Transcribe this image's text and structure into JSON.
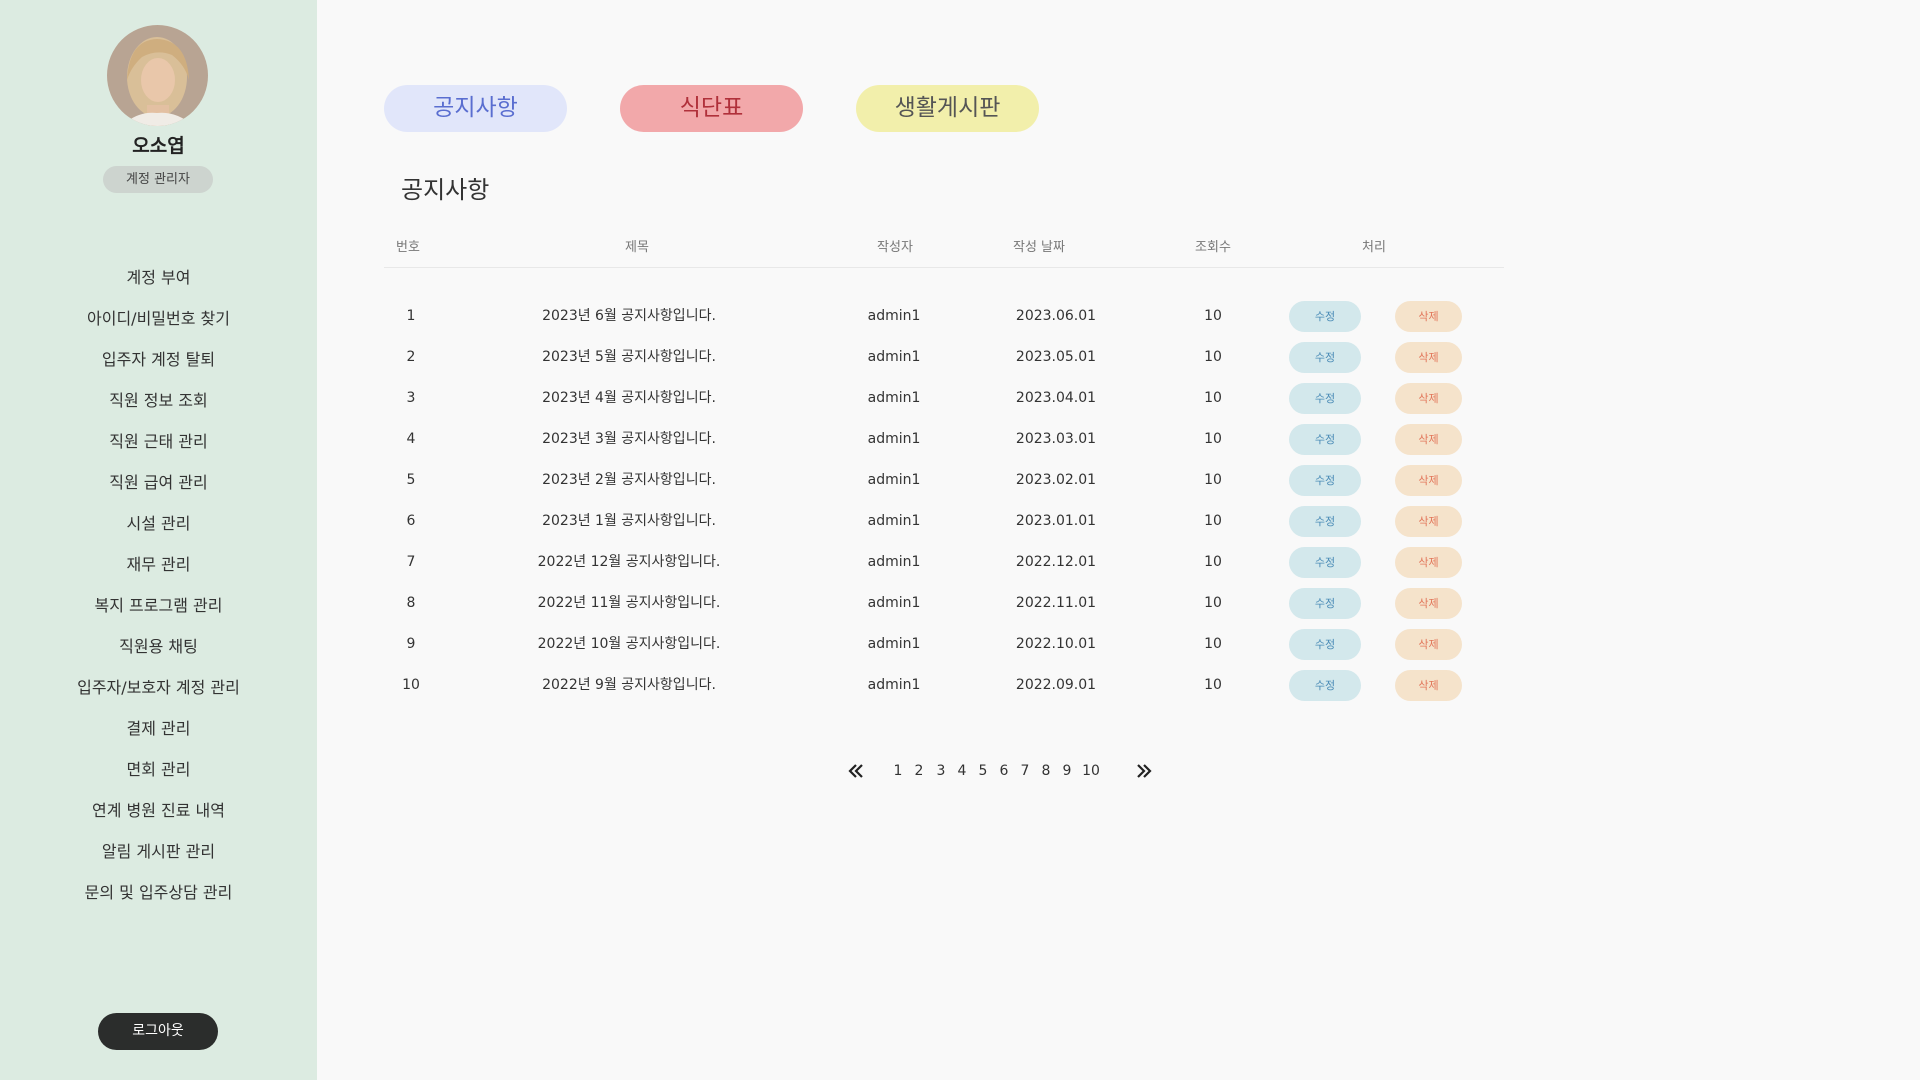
{
  "profile": {
    "name": "오소엽",
    "role": "계정 관리자"
  },
  "sidebar": {
    "items": [
      "계정 부여",
      "아이디/비밀번호 찾기",
      "입주자 계정 탈퇴",
      "직원 정보 조회",
      "직원 근태 관리",
      "직원 급여 관리",
      "시설 관리",
      "재무 관리",
      "복지 프로그램 관리",
      "직원용 채팅",
      "입주자/보호자 계정 관리",
      "결제 관리",
      "면회 관리",
      "연계 병원 진료 내역",
      "알림 게시판 관리",
      "문의 및 입주상담 관리"
    ],
    "logout": "로그아웃"
  },
  "tabs": {
    "notice": "공지사항",
    "menu": "식단표",
    "board": "생활게시판"
  },
  "section_title": "공지사항",
  "table": {
    "headers": {
      "no": "번호",
      "title": "제목",
      "author": "작성자",
      "date": "작성 날짜",
      "views": "조회수",
      "action": "처리"
    },
    "edit_label": "수정",
    "delete_label": "삭제",
    "rows": [
      {
        "no": "1",
        "title": "2023년 6월 공지사항입니다.",
        "author": "admin1",
        "date": "2023.06.01",
        "views": "10"
      },
      {
        "no": "2",
        "title": "2023년 5월 공지사항입니다.",
        "author": "admin1",
        "date": "2023.05.01",
        "views": "10"
      },
      {
        "no": "3",
        "title": "2023년 4월 공지사항입니다.",
        "author": "admin1",
        "date": "2023.04.01",
        "views": "10"
      },
      {
        "no": "4",
        "title": "2023년 3월 공지사항입니다.",
        "author": "admin1",
        "date": "2023.03.01",
        "views": "10"
      },
      {
        "no": "5",
        "title": "2023년 2월 공지사항입니다.",
        "author": "admin1",
        "date": "2023.02.01",
        "views": "10"
      },
      {
        "no": "6",
        "title": "2023년 1월 공지사항입니다.",
        "author": "admin1",
        "date": "2023.01.01",
        "views": "10"
      },
      {
        "no": "7",
        "title": "2022년 12월 공지사항입니다.",
        "author": "admin1",
        "date": "2022.12.01",
        "views": "10"
      },
      {
        "no": "8",
        "title": "2022년 11월 공지사항입니다.",
        "author": "admin1",
        "date": "2022.11.01",
        "views": "10"
      },
      {
        "no": "9",
        "title": "2022년 10월 공지사항입니다.",
        "author": "admin1",
        "date": "2022.10.01",
        "views": "10"
      },
      {
        "no": "10",
        "title": "2022년 9월 공지사항입니다.",
        "author": "admin1",
        "date": "2022.09.01",
        "views": "10"
      }
    ]
  },
  "pagination": {
    "pages": [
      "1",
      "2",
      "3",
      "4",
      "5",
      "6",
      "7",
      "8",
      "9",
      "10"
    ],
    "prev_icon": "double-chevron-left-icon",
    "next_icon": "double-chevron-right-icon"
  }
}
